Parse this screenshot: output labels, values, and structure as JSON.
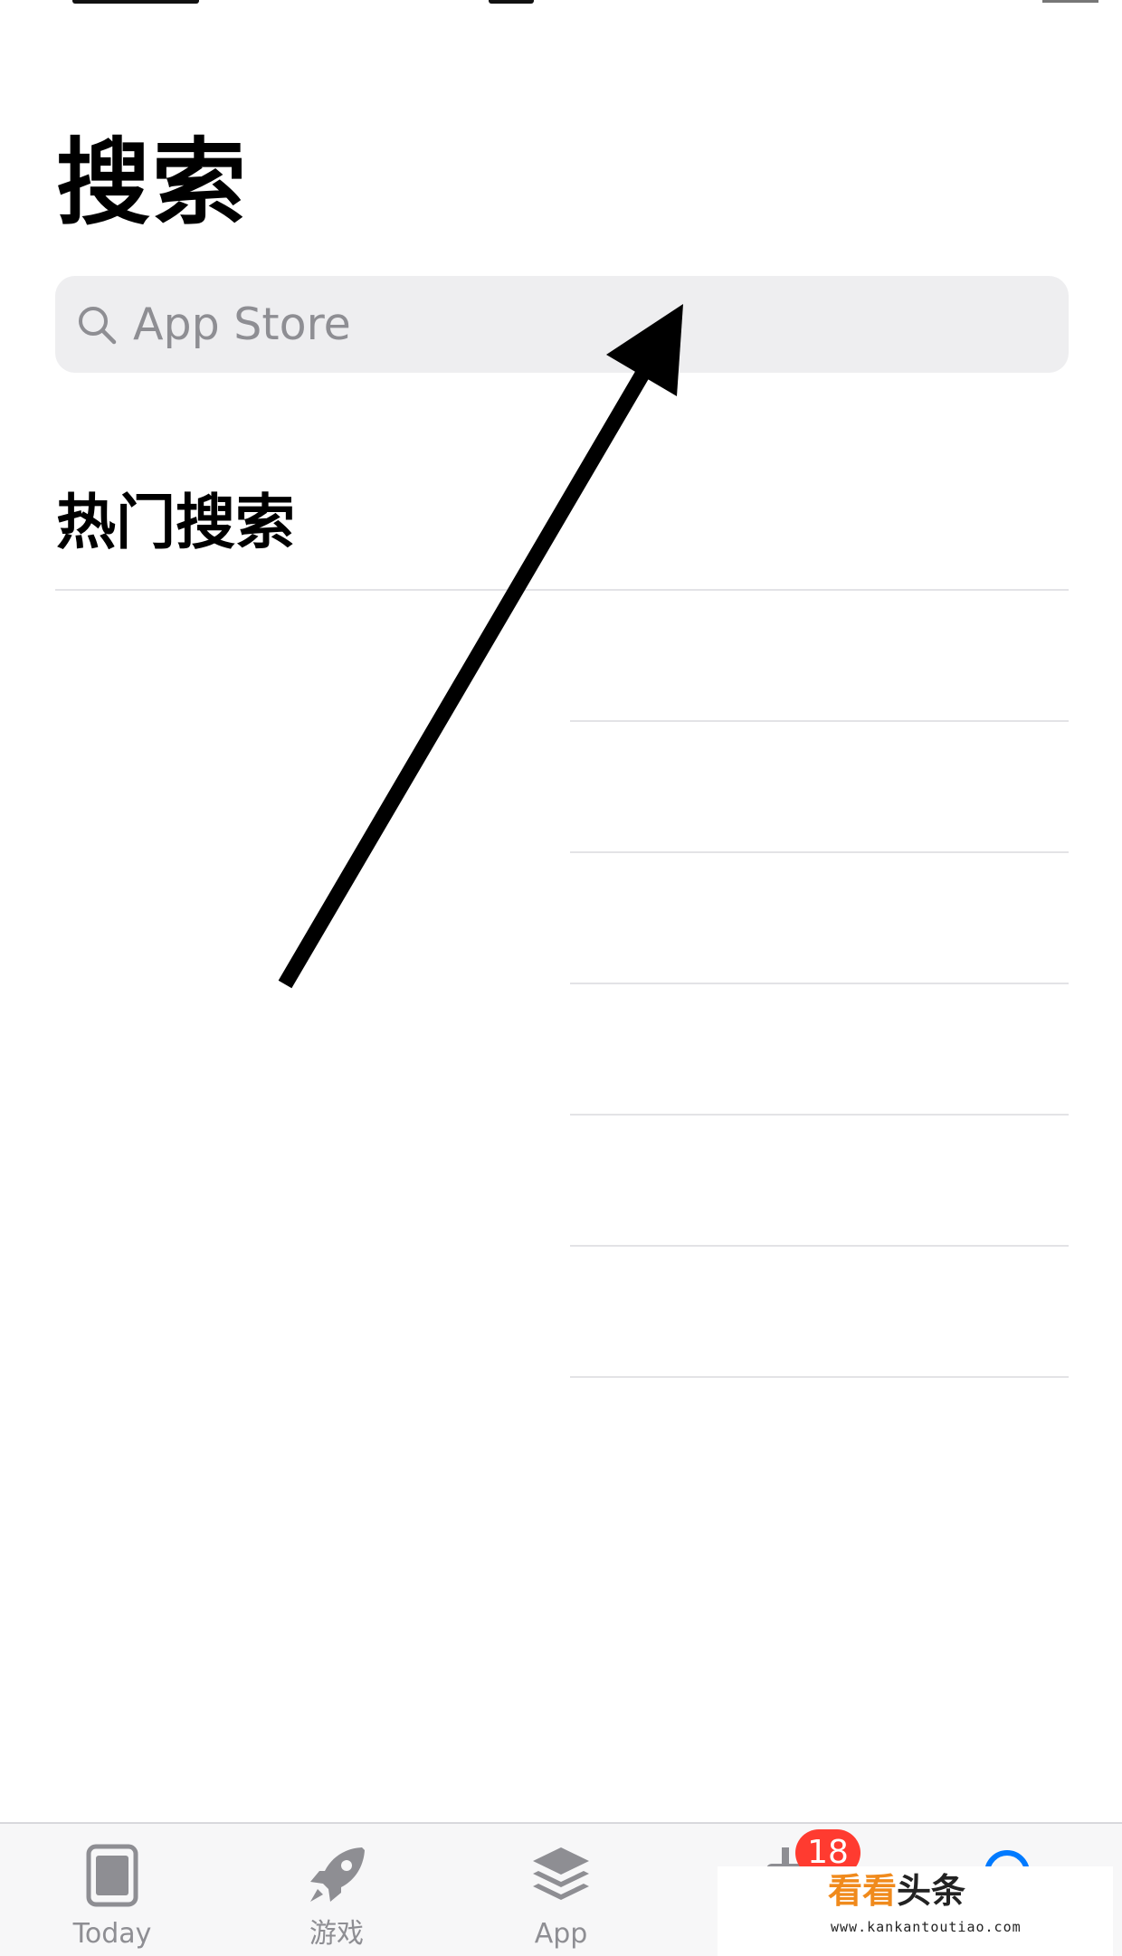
{
  "page": {
    "title": "搜索",
    "accent_color": "#007aff"
  },
  "search": {
    "placeholder": "App Store",
    "value": "",
    "icon": "magnifier-icon"
  },
  "trending": {
    "heading": "热门搜索",
    "items": []
  },
  "annotation": {
    "type": "arrow",
    "color": "#000000",
    "points_to": "search-bar"
  },
  "tab_bar": {
    "tabs": [
      {
        "id": "today",
        "label": "Today",
        "icon": "today-card-icon",
        "active": false
      },
      {
        "id": "games",
        "label": "游戏",
        "icon": "rocket-icon",
        "active": false
      },
      {
        "id": "apps",
        "label": "App",
        "icon": "layers-icon",
        "active": false
      },
      {
        "id": "updates",
        "label": "",
        "icon": "download-tray-icon",
        "badge": "18",
        "active": false
      },
      {
        "id": "search",
        "label": "",
        "icon": "search-icon",
        "active": true
      }
    ]
  },
  "watermark": {
    "text_orange": "看看",
    "text_dark": "头条",
    "url": "www.kankantoutiao.com"
  }
}
